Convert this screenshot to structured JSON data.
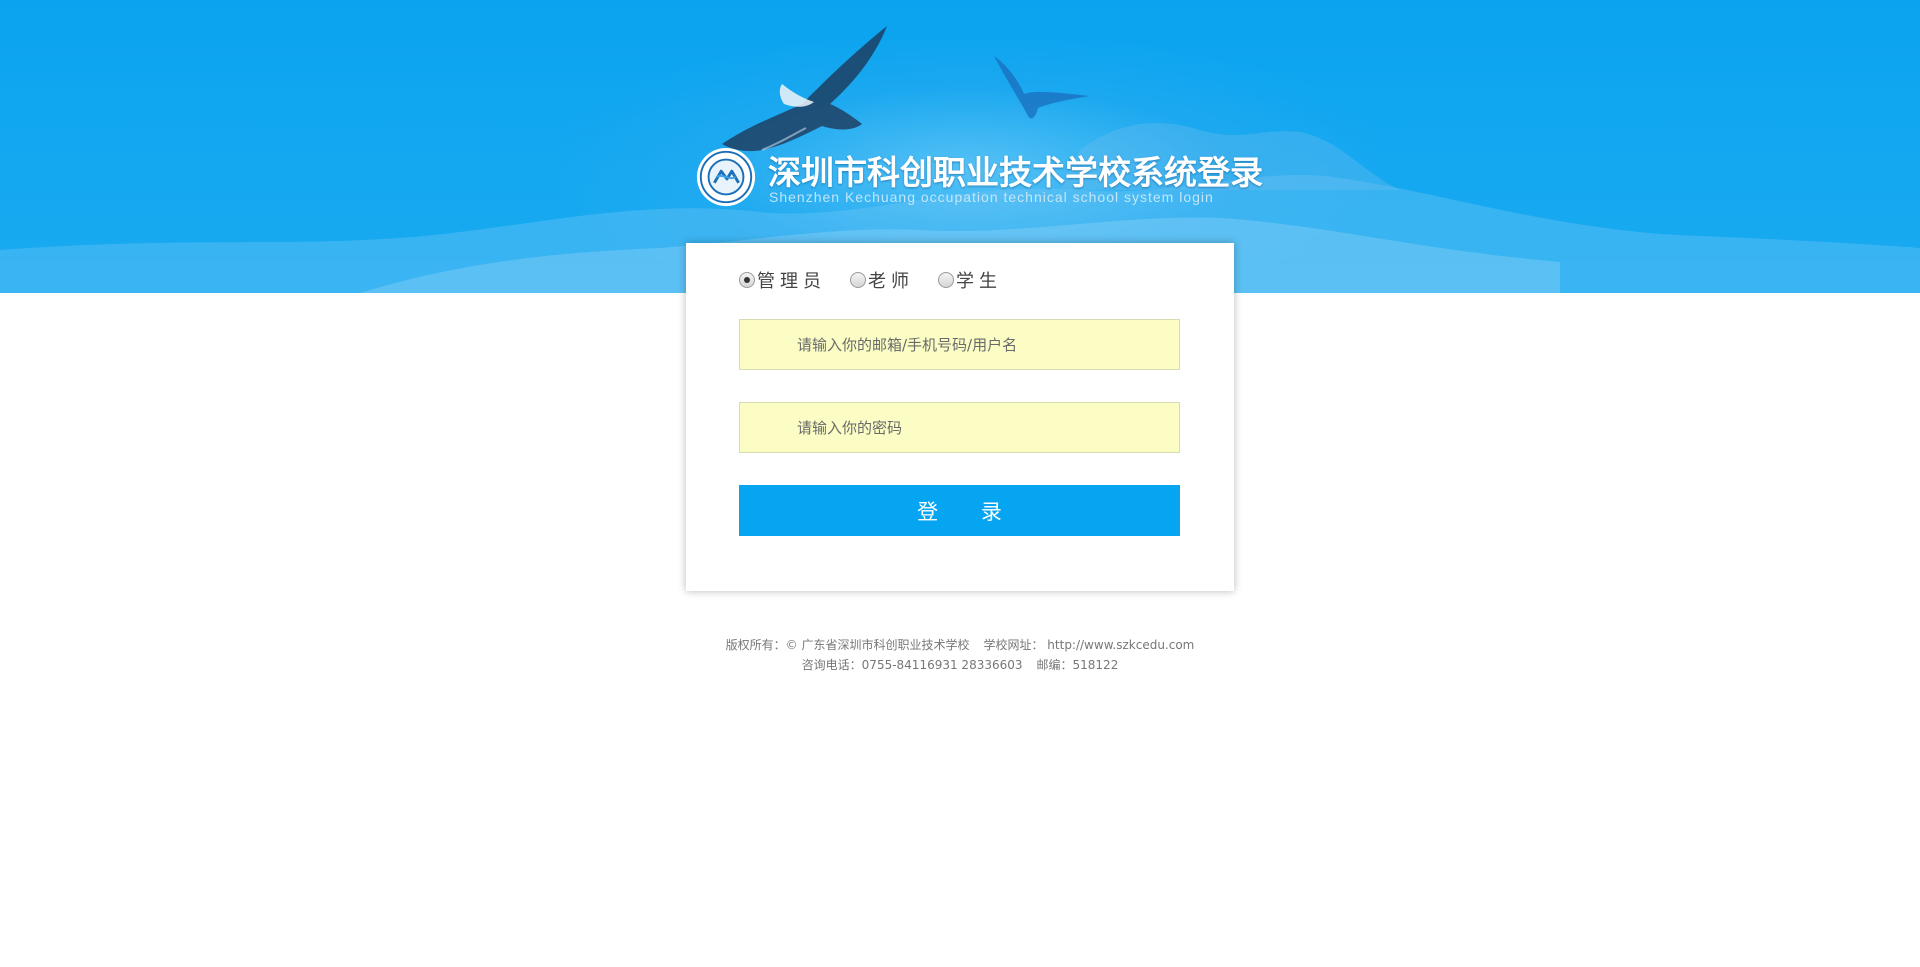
{
  "header": {
    "title_cn": "深圳市科创职业技术学校系统登录",
    "title_en": "Shenzhen Kechuang occupation technical school system login",
    "logo_icon": "school-seal-logo",
    "background_color": "#0ba3ef"
  },
  "login": {
    "roles": [
      {
        "label": "管理员",
        "checked": true
      },
      {
        "label": "老师",
        "checked": false
      },
      {
        "label": "学生",
        "checked": false
      }
    ],
    "username_placeholder": "请输入你的邮箱/手机号码/用户名",
    "password_placeholder": "请输入你的密码",
    "submit_label": "登 录",
    "button_color": "#06a5f1",
    "field_color": "#fbfdc4"
  },
  "footer": {
    "copyright": "版权所有：© 广东省深圳市科创职业技术学校",
    "website_label": "学校网址：",
    "website": "http://www.szkcedu.com",
    "phone": "咨询电话：0755-84116931 28336603",
    "postcode": "邮编：518122"
  }
}
